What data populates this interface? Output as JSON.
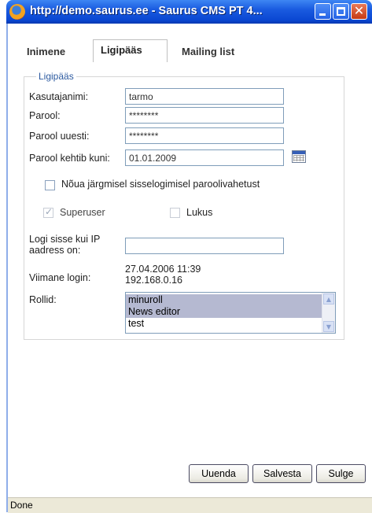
{
  "window": {
    "title": "http://demo.saurus.ee - Saurus CMS PT 4..."
  },
  "tabs": [
    {
      "label": "Inimene"
    },
    {
      "label": "Ligipääs"
    },
    {
      "label": "Mailing list"
    }
  ],
  "form": {
    "legend": "Ligipääs",
    "username_label": "Kasutajanimi:",
    "username_value": "tarmo",
    "password_label": "Parool:",
    "password_value": "********",
    "password_again_label": "Parool uuesti:",
    "password_again_value": "********",
    "expires_label": "Parool kehtib kuni:",
    "expires_value": "01.01.2009",
    "require_change_label": "Nõua järgmisel sisselogimisel paroolivahetust",
    "require_change_checked": false,
    "superuser_label": "Superuser",
    "superuser_checked": true,
    "locked_label": "Lukus",
    "locked_checked": false,
    "ip_label_line1": "Logi sisse kui IP",
    "ip_label_line2": "aadress on:",
    "ip_value": "",
    "last_login_label": "Viimane login:",
    "last_login_time": "27.04.2006 11:39",
    "last_login_ip": "192.168.0.16",
    "roles_label": "Rollid:",
    "roles": [
      {
        "name": "minuroll",
        "selected": true
      },
      {
        "name": "News editor",
        "selected": true
      },
      {
        "name": "test",
        "selected": false
      }
    ]
  },
  "buttons": {
    "refresh": "Uuenda",
    "save": "Salvesta",
    "close": "Sulge"
  },
  "status": {
    "text": "Done"
  }
}
